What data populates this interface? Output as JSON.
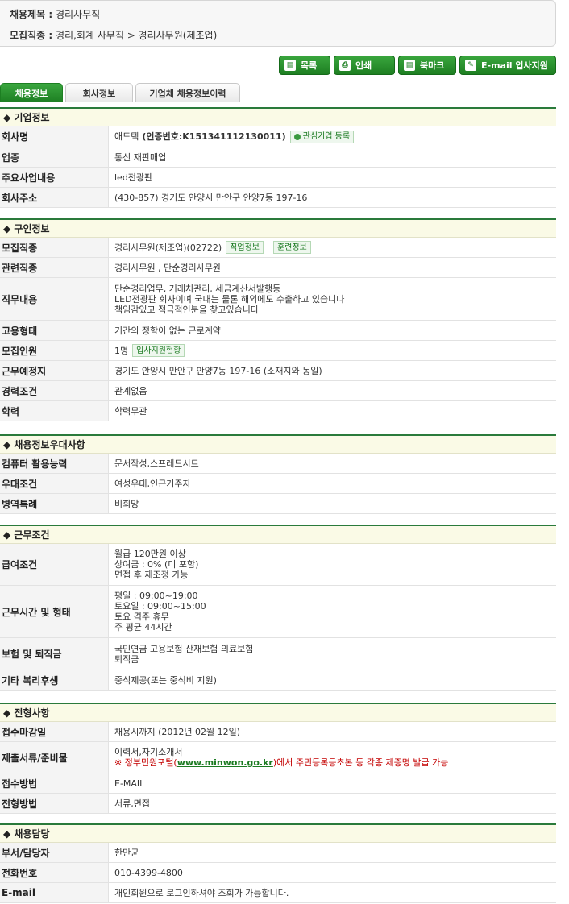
{
  "header": {
    "title_label": "채용제목 :",
    "title_value": "경리사무직",
    "category_label": "모집직종 :",
    "category_value": "경리,회계 사무직 > 경리사무원(제조업)"
  },
  "toolbar": {
    "list": "목록",
    "print": "인쇄",
    "bookmark": "북마크",
    "email_apply": "E-mail 입사지원"
  },
  "tabs": [
    {
      "label": "채용정보"
    },
    {
      "label": "회사정보"
    },
    {
      "label": "기업체 채용정보이력"
    }
  ],
  "company": {
    "heading": "◆ 기업정보",
    "name_label": "회사명",
    "name": "애드텍",
    "cert": "(인증번호:K151341112130011)",
    "interest_btn": "관심기업 등록",
    "industry_label": "업종",
    "industry": "통신 재판매업",
    "business_label": "주요사업내용",
    "business": "led전광판",
    "address_label": "회사주소",
    "address": "(430-857) 경기도 안양시 만안구 안양7동 197-16"
  },
  "job": {
    "heading": "◆ 구인정보",
    "category_label": "모집직종",
    "category": "경리사무원(제조업)(02722)",
    "job_info_btn": "직업정보",
    "training_btn": "훈련정보",
    "related_label": "관련직종",
    "related": "경리사무원 , 단순경리사무원",
    "duties_label": "직무내용",
    "duties": [
      "단순경리업무, 거래처관리, 세금계산서발행등",
      "LED전광판 회사이며 국내는 물론 해외에도 수출하고 있습니다",
      "책임감있고 적극적인분을 찾고있습니다"
    ],
    "employment_label": "고용형태",
    "employment": "기간의 정함이 없는 근로계약",
    "headcount_label": "모집인원",
    "headcount": "1명",
    "applicants_btn": "입사지원현황",
    "location_label": "근무예정지",
    "location": "경기도 안양시 만안구 안양7동 197-16 (소재지와 동일)",
    "experience_label": "경력조건",
    "experience": "관계없음",
    "education_label": "학력",
    "education": "학력무관"
  },
  "preference": {
    "heading": "◆ 채용정보우대사항",
    "computer_label": "컴퓨터 활용능력",
    "computer": "문서작성,스프레드시트",
    "pref_label": "우대조건",
    "pref": "여성우대,인근거주자",
    "military_label": "병역특례",
    "military": "비희망"
  },
  "conditions": {
    "heading": "◆ 근무조건",
    "salary_label": "급여조건",
    "salary": [
      "월급 120만원 이상",
      "상여금 : 0% (미 포함)",
      "면접 후 재조정 가능"
    ],
    "hours_label": "근무시간 및 형태",
    "hours": [
      "평일 : 09:00~19:00",
      "토요일 : 09:00~15:00",
      "토요 격주 휴무",
      "주 평균 44시간"
    ],
    "insurance_label": "보험 및 퇴직금",
    "insurance": [
      "국민연금 고용보험 산재보험 의료보험",
      "퇴직금"
    ],
    "welfare_label": "기타 복리후생",
    "welfare": "중식제공(또는 중식비 지원)"
  },
  "selection": {
    "heading": "◆ 전형사항",
    "deadline_label": "접수마감일",
    "deadline": "채용시까지 (2012년 02월 12일)",
    "docs_label": "제출서류/준비물",
    "docs": "이력서,자기소개서",
    "docs_note_pre": "※ 정부민원포털(",
    "docs_note_link": "www.minwon.go.kr",
    "docs_note_post": ")에서 주민등록등초본 등 각종 제증명 발급 가능",
    "method_label": "접수방법",
    "method": "E-MAIL",
    "process_label": "전형방법",
    "process": "서류,면접"
  },
  "contact": {
    "heading": "◆ 채용담당",
    "dept_label": "부서/담당자",
    "dept": "한만균",
    "phone_label": "전화번호",
    "phone": "010-4399-4800",
    "email_label": "E-mail",
    "email": "개인회원으로 로그인하셔야 조회가 가능합니다."
  }
}
